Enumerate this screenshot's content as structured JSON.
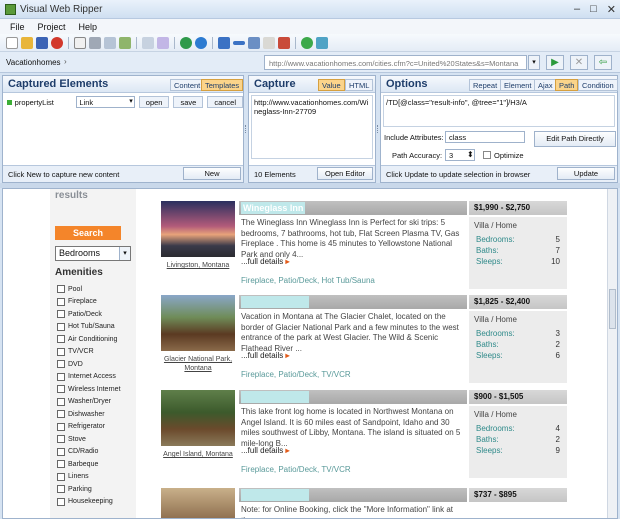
{
  "window": {
    "title": "Visual Web Ripper",
    "min": "–",
    "max": "□",
    "close": "✕"
  },
  "menu": [
    "File",
    "Project",
    "Help"
  ],
  "address": {
    "breadcrumb": "Vacationhomes",
    "chevron": "›",
    "url": "http://www.vacationhomes.com/cities.cfm?c=United%20States&s=Montana",
    "dropdown": "▾",
    "go": "▶",
    "stop": "✕",
    "back": "⇦"
  },
  "captured": {
    "title": "Captured Elements",
    "tabs": [
      "Content",
      "Templates"
    ],
    "element": {
      "name": "propertyList",
      "type": "Link",
      "arrow": "▾"
    },
    "buttons": [
      "open",
      "save",
      "cancel"
    ],
    "footer": "Click New to capture new content",
    "new_btn": "New"
  },
  "capture": {
    "title": "Capture",
    "tabs": [
      "Value",
      "HTML"
    ],
    "text": "http://www.vacationhomes.com/Wineglass-Inn-27709",
    "footer": "10 Elements",
    "editor_btn": "Open Editor"
  },
  "options": {
    "title": "Options",
    "tabs": [
      "Repeat",
      "Element",
      "Ajax",
      "Path",
      "Condition"
    ],
    "xpath": "/TD[@class=\"result-info\", @tree=\"1\"]/H3/A",
    "include_label": "Include Attributes:",
    "include_value": "class",
    "edit_btn": "Edit Path Directly",
    "accuracy_label": "Path Accuracy:",
    "accuracy_value": "3",
    "spin": "⬍",
    "optimize": "Optimize",
    "footer": "Click Update to update selection in browser",
    "update_btn": "Update"
  },
  "sidebar": {
    "refine": "Refine your results",
    "search": "Search",
    "bedrooms": "Bedrooms",
    "bed_arrow": "▾",
    "amenities_title": "Amenities",
    "amenities": [
      "Pool",
      "Fireplace",
      "Patio/Deck",
      "Hot Tub/Sauna",
      "Air Conditioning",
      "TV/VCR",
      "DVD",
      "Internet Access",
      "Wireless Internet",
      "Washer/Dryer",
      "Dishwasher",
      "Refrigerator",
      "Stove",
      "CD/Radio",
      "Barbeque",
      "Linens",
      "Parking",
      "Housekeeping"
    ]
  },
  "listings": [
    {
      "title": "Wineglass Inn",
      "price": "$1,990 - $2,750",
      "location": "Livingston, Montana",
      "desc": "The Wineglass Inn Wineglass Inn is Perfect for ski trips: 5 bedrooms, 7 bathrooms, hot tub, Flat Screen Plasma TV, Gas Fireplace . This home is 45 minutes to Yellowstone National Park and only 4...",
      "full": "...full details",
      "amenities": "Fireplace, Patio/Deck, Hot Tub/Sauna",
      "type": "Villa / Home",
      "bedrooms": "5",
      "baths": "7",
      "sleeps": "10"
    },
    {
      "title": "",
      "price": "$1,825 - $2,400",
      "location": "Glacier National Park, Montana",
      "desc": "Vacation in Montana at The Glacier Chalet, located on the border of Glacier National Park and a few minutes to the west entrance of the park at West Glacier. The Wild & Scenic Flathead River ...",
      "full": "...full details",
      "amenities": "Fireplace, Patio/Deck, TV/VCR",
      "type": "Villa / Home",
      "bedrooms": "3",
      "baths": "2",
      "sleeps": "6"
    },
    {
      "title": "",
      "price": "$900 - $1,505",
      "location": "Angel Island, Montana",
      "desc": "This lake front log home is located in Northwest Montana on Angel Island. It is 60 miles east of Sandpoint, Idaho and 30 miles southwest of Libby, Montana. The island is situated on 5 mile-long B...",
      "full": "...full details",
      "amenities": "Fireplace, Patio/Deck, TV/VCR",
      "type": "Villa / Home",
      "bedrooms": "4",
      "baths": "2",
      "sleeps": "9"
    },
    {
      "title": "",
      "price": "$737 - $895",
      "location": "",
      "desc": "Note: for Online Booking, click the \"More Information\" link at the",
      "full": "",
      "amenities": "",
      "type": "",
      "bedrooms": "",
      "baths": "",
      "sleeps": ""
    }
  ],
  "labels": {
    "bedrooms": "Bedrooms:",
    "baths": "Baths:",
    "sleeps": "Sleeps:",
    "full_arrow": "▸"
  }
}
